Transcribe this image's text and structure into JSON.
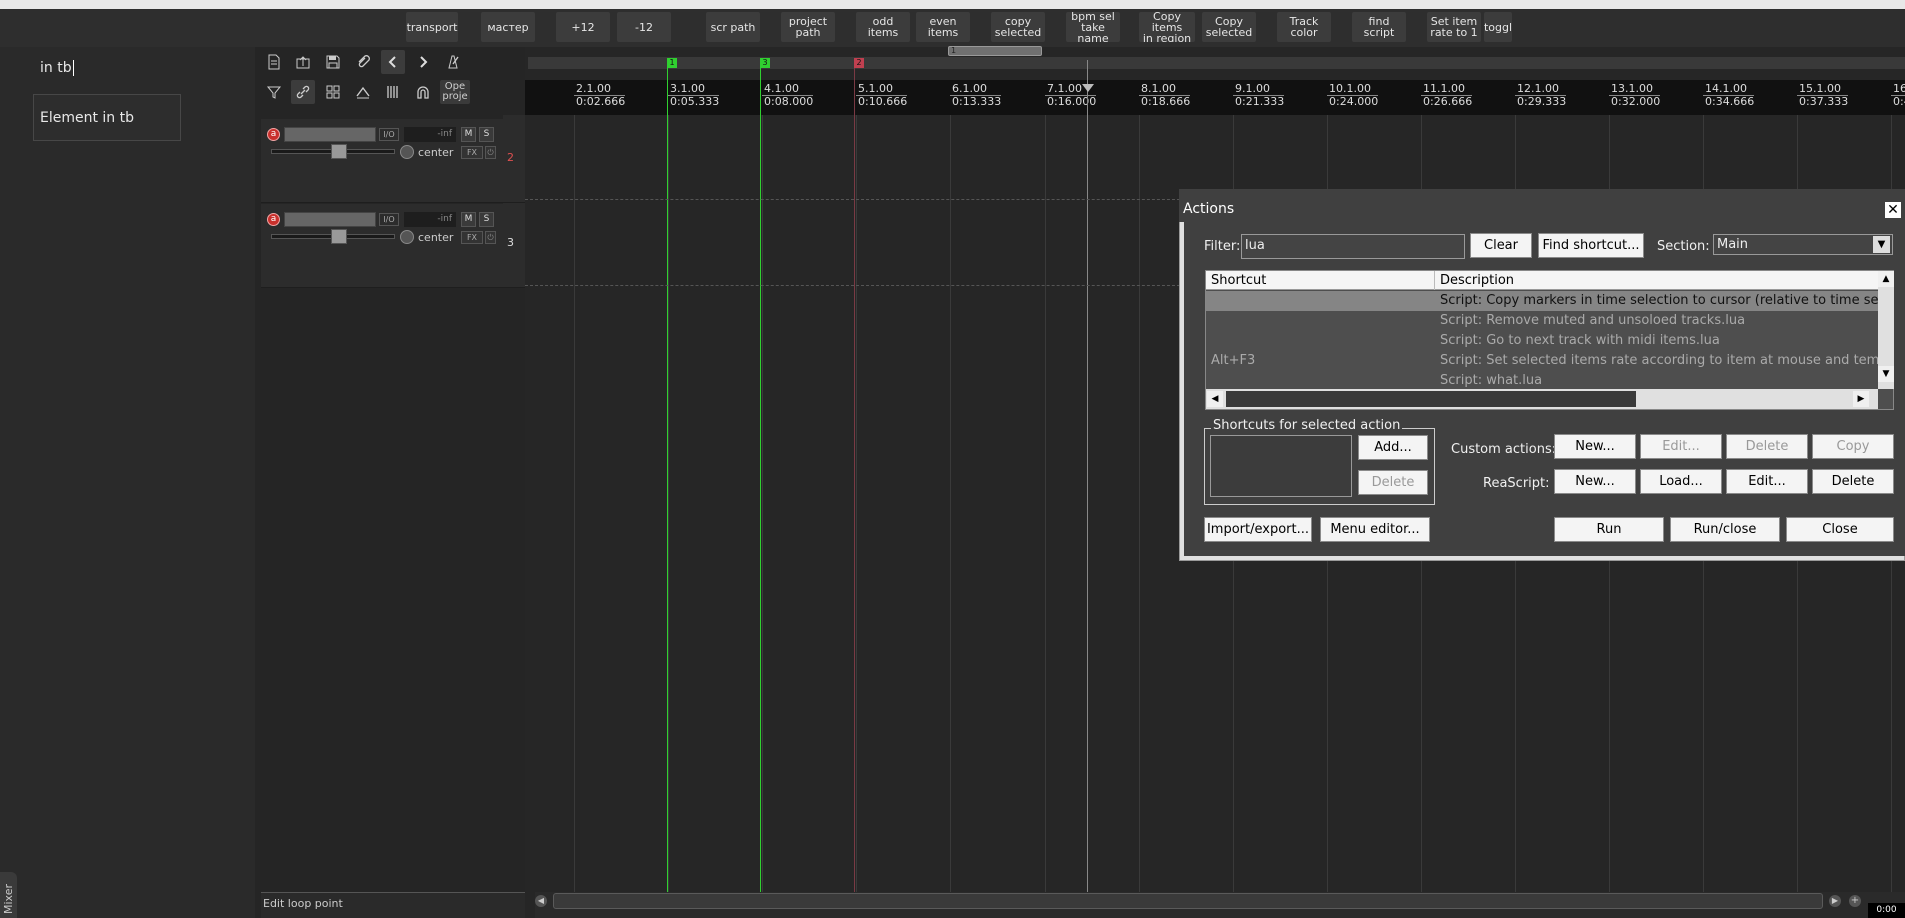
{
  "toolbar": {
    "buttons": [
      {
        "label": "transport"
      },
      {
        "label": "мастер"
      },
      {
        "label": "+12"
      },
      {
        "label": "-12"
      },
      {
        "label": "scr path"
      },
      {
        "label": "project\npath"
      },
      {
        "label": "odd items"
      },
      {
        "label": "even items"
      },
      {
        "label": "copy\nselected"
      },
      {
        "label": "bpm sel\ntake name"
      },
      {
        "label": "Copy items\nin region"
      },
      {
        "label": "Copy\nselected"
      },
      {
        "label": "Track\ncolor"
      },
      {
        "label": "find script"
      },
      {
        "label": "Set item\nrate to 1"
      },
      {
        "label": "toggl"
      }
    ]
  },
  "left_panel": {
    "search_text": "in tb",
    "result_text": "Element in tb",
    "mixer_tab": "Mixer"
  },
  "tcp_toolbar": {
    "open_project_label": "Ope\nproje",
    "icons": [
      "new-project-icon",
      "open-icon",
      "save-icon",
      "paperclip-icon",
      "undo-icon",
      "redo-icon",
      "metronome-icon",
      "filter-icon",
      "link-icon",
      "grid-icon",
      "envelope-icon",
      "ripple-icon",
      "snap-magnet-icon"
    ]
  },
  "tracks": [
    {
      "number": "2",
      "volume": "-inf",
      "pan": "center",
      "io": "I/O",
      "mute": "M",
      "solo": "S",
      "fx": "FX",
      "rec": "a",
      "number_color": "#e05050"
    },
    {
      "number": "3",
      "volume": "-inf",
      "pan": "center",
      "io": "I/O",
      "mute": "M",
      "solo": "S",
      "fx": "FX",
      "rec": "a",
      "number_color": "#dddddd"
    }
  ],
  "status": {
    "text": "Edit loop point"
  },
  "timeline": {
    "ruler": [
      {
        "bar": "2.1.00",
        "time": "0:02.666"
      },
      {
        "bar": "3.1.00",
        "time": "0:05.333"
      },
      {
        "bar": "4.1.00",
        "time": "0:08.000"
      },
      {
        "bar": "5.1.00",
        "time": "0:10.666"
      },
      {
        "bar": "6.1.00",
        "time": "0:13.333"
      },
      {
        "bar": "7.1.00",
        "time": "0:16.000"
      },
      {
        "bar": "8.1.00",
        "time": "0:18.666"
      },
      {
        "bar": "9.1.00",
        "time": "0:21.333"
      },
      {
        "bar": "10.1.00",
        "time": "0:24.000"
      },
      {
        "bar": "11.1.00",
        "time": "0:26.666"
      },
      {
        "bar": "12.1.00",
        "time": "0:29.333"
      },
      {
        "bar": "13.1.00",
        "time": "0:32.000"
      },
      {
        "bar": "14.1.00",
        "time": "0:34.666"
      },
      {
        "bar": "15.1.00",
        "time": "0:37.333"
      },
      {
        "bar": "16.",
        "time": "0:4"
      }
    ],
    "region_label": "1",
    "markers": [
      {
        "label": "1",
        "color": "#30d030"
      },
      {
        "label": "3",
        "color": "#30d030"
      },
      {
        "label": "2",
        "color": "#c04050"
      }
    ],
    "time_display": "0:00"
  },
  "actions_dialog": {
    "title": "Actions",
    "filter_label": "Filter:",
    "filter_value": "lua",
    "clear_label": "Clear",
    "find_shortcut_label": "Find shortcut...",
    "section_label": "Section:",
    "section_value": "Main",
    "columns": {
      "shortcut": "Shortcut",
      "description": "Description"
    },
    "rows": [
      {
        "shortcut": "",
        "description": "Script: Copy markers in time selection to cursor (relative to time selection",
        "selected": true
      },
      {
        "shortcut": "",
        "description": "Script: Remove muted and unsoloed tracks.lua",
        "selected": false
      },
      {
        "shortcut": "",
        "description": "Script: Go to next track with midi items.lua",
        "selected": false
      },
      {
        "shortcut": "Alt+F3",
        "description": "Script: Set selected items rate according to item at mouse and tempo mar",
        "selected": false
      },
      {
        "shortcut": "",
        "description": "Script: what.lua",
        "selected": false
      }
    ],
    "shortcuts_group_label": "Shortcuts for selected action",
    "add_label": "Add...",
    "delete_shortcut_label": "Delete",
    "custom_actions_label": "Custom actions:",
    "custom_new": "New...",
    "custom_edit": "Edit...",
    "custom_delete": "Delete",
    "custom_copy": "Copy",
    "reascript_label": "ReaScript:",
    "rs_new": "New...",
    "rs_load": "Load...",
    "rs_edit": "Edit...",
    "rs_delete": "Delete",
    "import_export": "Import/export...",
    "menu_editor": "Menu editor...",
    "run": "Run",
    "run_close": "Run/close",
    "close": "Close",
    "close_x": "✕"
  }
}
